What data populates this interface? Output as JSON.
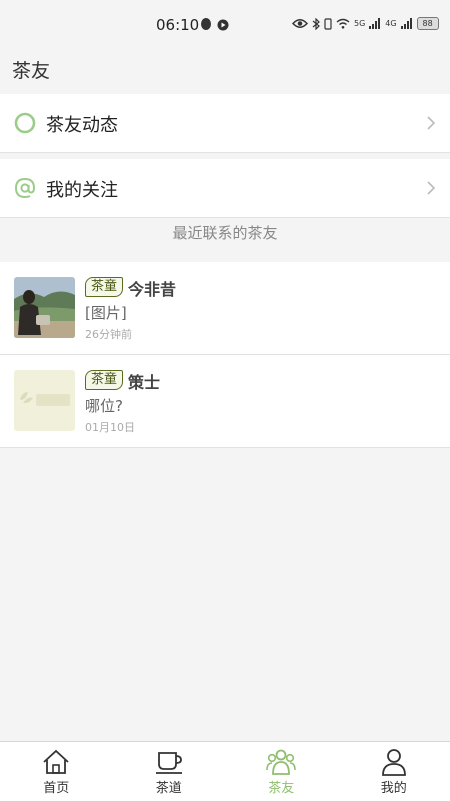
{
  "status_bar": {
    "time": "06:10",
    "network_left": "5G",
    "network_right": "4G",
    "battery": "88"
  },
  "header": {
    "title": "茶友"
  },
  "menu": [
    {
      "label": "茶友动态",
      "icon": "circle-icon"
    },
    {
      "label": "我的关注",
      "icon": "at-icon"
    }
  ],
  "section": {
    "title": "最近联系的茶友"
  },
  "friends": [
    {
      "badge": "茶童",
      "name": "今非昔",
      "message": "[图片]",
      "time": "26分钟前",
      "avatar": "photo-avatar"
    },
    {
      "badge": "茶童",
      "name": "策士",
      "message": "哪位?",
      "time": "01月10日",
      "avatar": "logo-avatar"
    }
  ],
  "nav": [
    {
      "label": "首页",
      "icon": "home-icon",
      "active": false
    },
    {
      "label": "茶道",
      "icon": "teacup-icon",
      "active": false
    },
    {
      "label": "茶友",
      "icon": "friends-icon",
      "active": true
    },
    {
      "label": "我的",
      "icon": "profile-icon",
      "active": false
    }
  ],
  "colors": {
    "accent": "#8fbf6e",
    "badge_border": "#5b6b1f"
  }
}
